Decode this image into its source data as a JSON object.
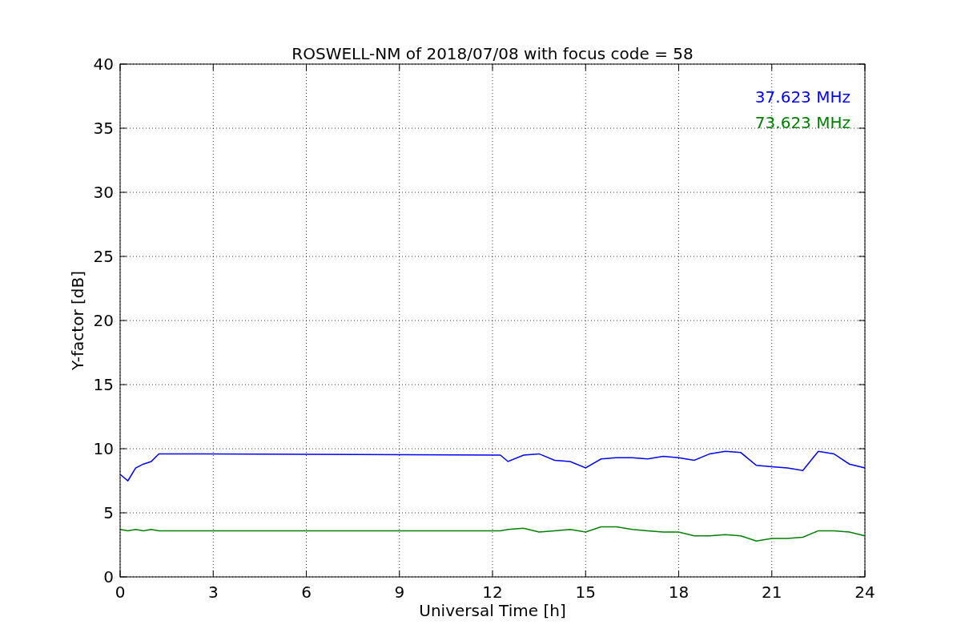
{
  "chart_data": {
    "type": "line",
    "title": "ROSWELL-NM of 2018/07/08 with focus code = 58",
    "xlabel": "Universal Time [h]",
    "ylabel": "Y-factor [dB]",
    "x": [
      0,
      0.25,
      0.5,
      0.75,
      1,
      1.25,
      1.5,
      12.25,
      12.5,
      13,
      13.5,
      14,
      14.5,
      15,
      15.5,
      16,
      16.5,
      17,
      17.5,
      18,
      18.5,
      19,
      19.5,
      20,
      20.5,
      21,
      21.5,
      22,
      22.5,
      23,
      23.5,
      24
    ],
    "series": [
      {
        "name": "37.623 MHz",
        "color": "#0000ff",
        "values": [
          8,
          7.5,
          8.5,
          8.8,
          9,
          9.6,
          9.6,
          9.5,
          9,
          9.5,
          9.6,
          9.1,
          9,
          8.5,
          9.2,
          9.3,
          9.3,
          9.2,
          9.4,
          9.3,
          9.1,
          9.6,
          9.8,
          9.7,
          8.7,
          8.6,
          8.5,
          8.3,
          9.8,
          9.6,
          8.8,
          8.5
        ]
      },
      {
        "name": "73.623 MHz",
        "color": "#008000",
        "values": [
          3.7,
          3.6,
          3.7,
          3.6,
          3.7,
          3.6,
          3.6,
          3.6,
          3.7,
          3.8,
          3.5,
          3.6,
          3.7,
          3.5,
          3.9,
          3.9,
          3.7,
          3.6,
          3.5,
          3.5,
          3.2,
          3.2,
          3.3,
          3.2,
          2.8,
          3.0,
          3.0,
          3.1,
          3.6,
          3.6,
          3.5,
          3.2
        ]
      }
    ],
    "grid": true,
    "xlim": [
      0,
      24
    ],
    "ylim": [
      0,
      40
    ],
    "xticks": [
      0,
      3,
      6,
      9,
      12,
      15,
      18,
      21,
      24
    ],
    "yticks": [
      0,
      5,
      10,
      15,
      20,
      25,
      30,
      35,
      40
    ]
  }
}
